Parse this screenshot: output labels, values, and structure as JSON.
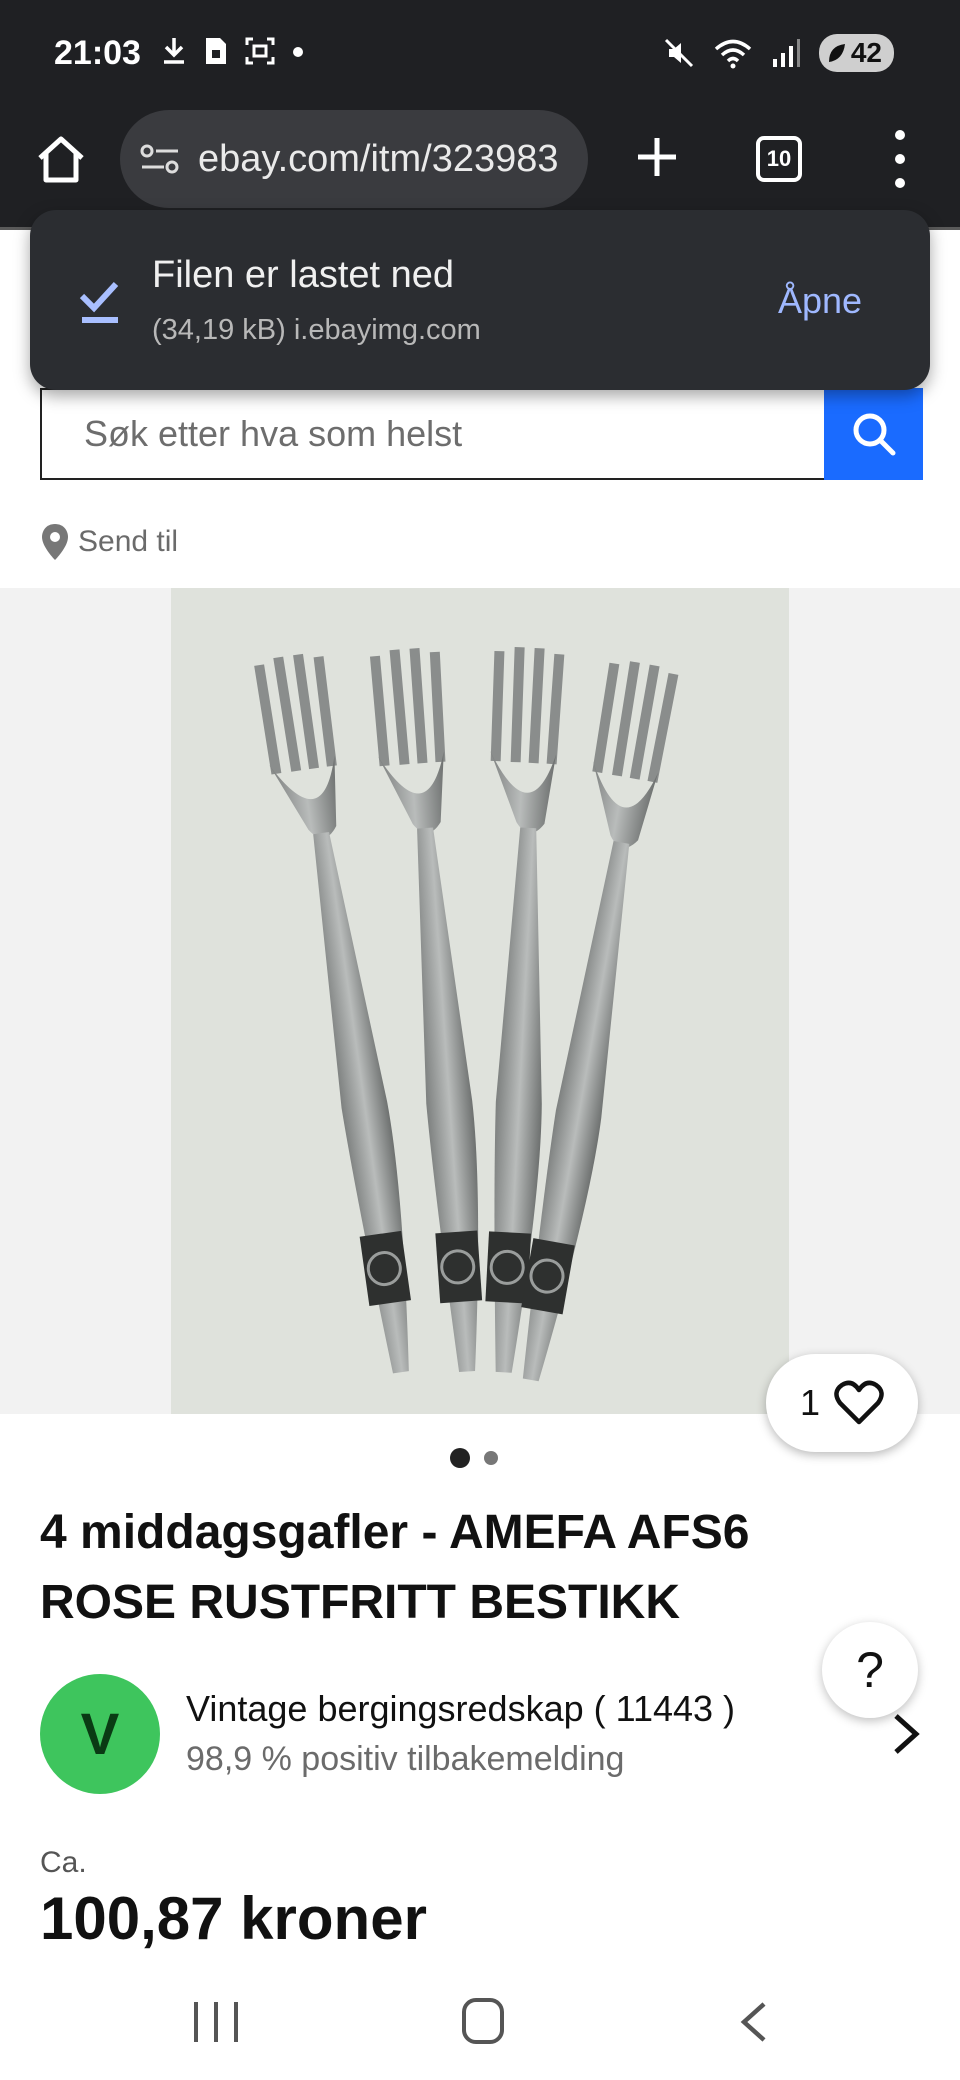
{
  "status_bar": {
    "time": "21:03",
    "battery": "42",
    "left_icons": [
      "download-icon",
      "sim-icon",
      "screenshot-icon",
      "dot-icon"
    ],
    "right_icons": [
      "mute-icon",
      "wifi-icon",
      "signal-icon",
      "battery-icon"
    ]
  },
  "browser": {
    "url": "ebay.com/itm/323983",
    "tab_count": "10"
  },
  "download_notice": {
    "title": "Filen er lastet ned",
    "details": "(34,19 kB) i.ebayimg.com",
    "action": "Åpne"
  },
  "search": {
    "placeholder": "Søk etter hva som helst"
  },
  "send_to": {
    "label": "Send til"
  },
  "gallery": {
    "like_count": "1",
    "current_index": 1,
    "total": 2
  },
  "product": {
    "title": "4 middagsgafler - AMEFA AFS6 ROSE RUSTFRITT BESTIKK"
  },
  "seller": {
    "initial": "V",
    "name": "Vintage bergingsredskap ( 11443 )",
    "feedback": "98,9 % positiv tilbakemelding"
  },
  "price": {
    "prefix": "Ca.",
    "value": "100,87 kroner"
  },
  "help": {
    "label": "?"
  },
  "colors": {
    "accent": "#1a6bff",
    "avatar": "#3ec55d",
    "toolbar": "#1f2023",
    "snackbar": "#2b2d31",
    "snackbar_action": "#9fb8ff"
  }
}
